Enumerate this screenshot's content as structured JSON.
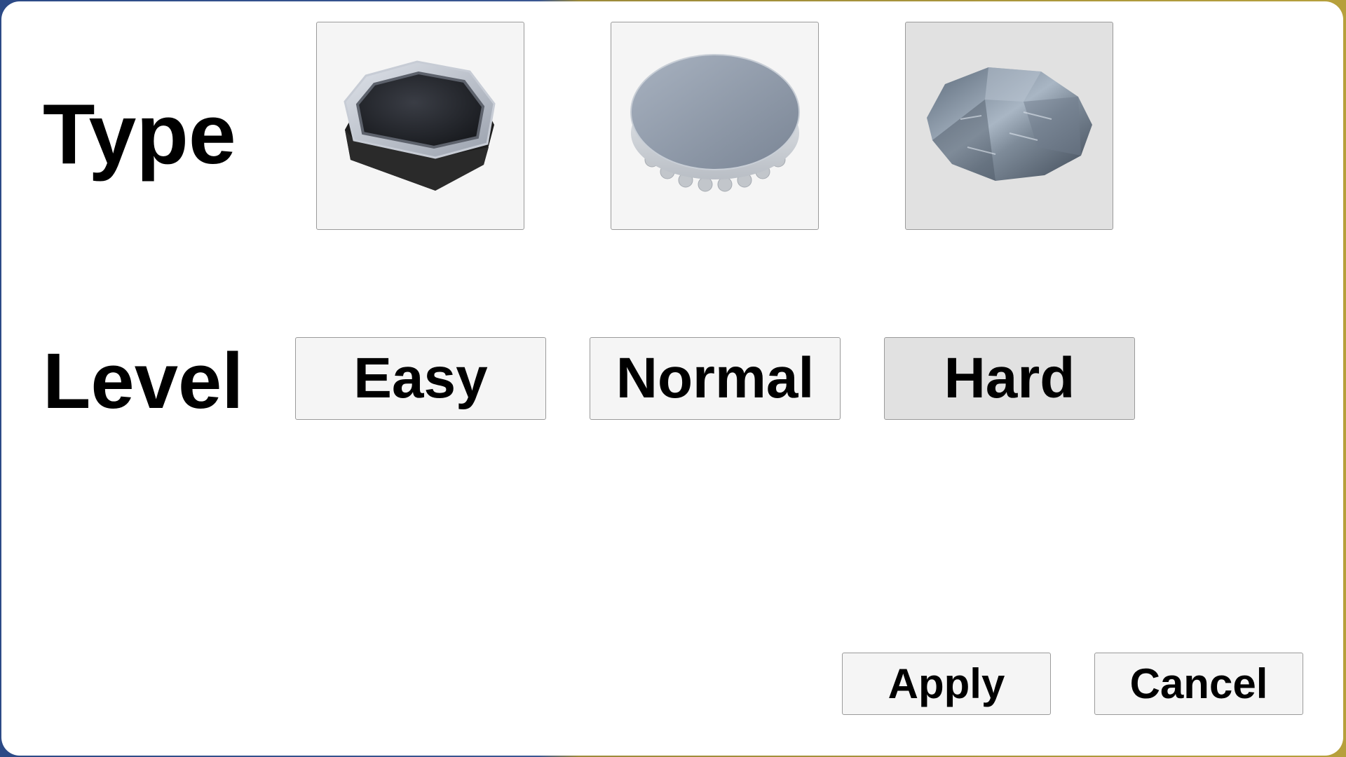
{
  "dialog": {
    "type_label": "Type",
    "level_label": "Level"
  },
  "type_options": [
    {
      "icon": "octagon-puck-icon",
      "selected": false
    },
    {
      "icon": "bottle-cap-icon",
      "selected": false
    },
    {
      "icon": "rock-icon",
      "selected": true
    }
  ],
  "levels": [
    {
      "label": "Easy",
      "selected": false
    },
    {
      "label": "Normal",
      "selected": false
    },
    {
      "label": "Hard",
      "selected": true
    }
  ],
  "actions": {
    "apply_label": "Apply",
    "cancel_label": "Cancel"
  },
  "colors": {
    "button_bg": "#f5f5f5",
    "selected_bg": "#e1e1e1",
    "border": "#9a9a9a"
  }
}
